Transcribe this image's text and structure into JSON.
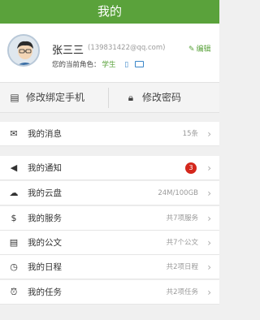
{
  "header": {
    "title": "我的"
  },
  "profile": {
    "name": "张三三",
    "email": "(139831422@qq.com)",
    "edit_label": "编辑",
    "role_label": "您的当前角色：",
    "role_value": "学生"
  },
  "actions": {
    "bind_phone": "修改绑定手机",
    "change_password": "修改密码"
  },
  "messages": {
    "label": "我的消息",
    "value": "15条"
  },
  "menu": [
    {
      "label": "我的通知",
      "value": "",
      "badge": "3"
    },
    {
      "label": "我的云盘",
      "value": "24M/100GB"
    },
    {
      "label": "我的服务",
      "value": "共7项服务"
    },
    {
      "label": "我的公文",
      "value": "共7个公文"
    },
    {
      "label": "我的日程",
      "value": "共2项日程"
    },
    {
      "label": "我的任务",
      "value": "共2项任务"
    }
  ],
  "colors": {
    "brand": "#5aa23b",
    "badge": "#d4271c"
  }
}
